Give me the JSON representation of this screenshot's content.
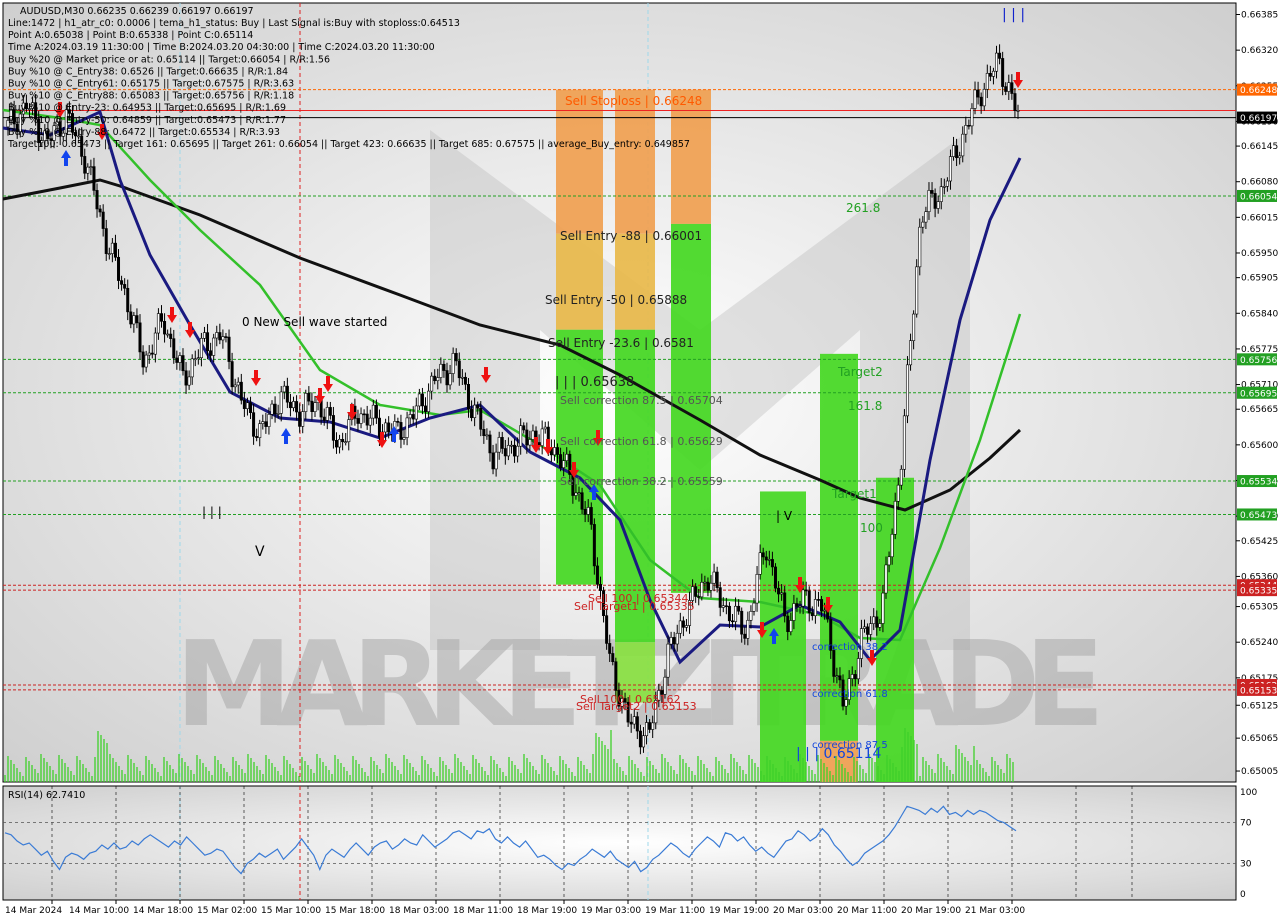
{
  "chart_data": [
    {
      "type": "candlestick",
      "symbol": "AUDUSD,M30",
      "ohlc_header": "AUDUSD,M30  0.66235 0.66239 0.66197 0.66197",
      "info_lines": [
        "Line:1472 | h1_atr_c0: 0.0006 | tema_h1_status: Buy | Last Signal is:Buy with stoploss:0.64513",
        "Point A:0.65038 | Point B:0.65338 | Point C:0.65114",
        "Time A:2024.03.19 11:30:00 | Time B:2024.03.20 04:30:00 | Time C:2024.03.20 11:30:00",
        "Buy %20 @ Market price or at: 0.65114 || Target:0.66054 | R/R:1.56",
        "Buy %10 @ C_Entry38: 0.6526 || Target:0.66635 | R/R:1.84",
        "Buy %10 @ C_Entry61: 0.65175 || Target:0.67575 | R/R:3.63",
        "Buy %10 @ C_Entry88: 0.65083 || Target:0.65756 | R/R:1.18",
        "Buy %10 @ Entry-23: 0.64953 || Target:0.65695 | R/R:1.69",
        "Buy %10 @ Entry-50: 0.64859 || Target:0.65473 | R/R:1.77",
        "Buy %10 @ Entry-88: 0.6472 || Target:0.65534 | R/R:3.93",
        "Target100: 0.65473 || Target 161: 0.65695 || Target 261: 0.66054 || Target 423: 0.66635 || Target 685: 0.67575 || average_Buy_entry: 0.649857"
      ],
      "y_ticks": [
        "0.66385",
        "0.66320",
        "0.66255",
        "0.66190",
        "0.66145",
        "0.66080",
        "0.66015",
        "0.65950",
        "0.65905",
        "0.65840",
        "0.65775",
        "0.65710",
        "0.65665",
        "0.65600",
        "0.65535",
        "0.65470",
        "0.65425",
        "0.65360",
        "0.65305",
        "0.65240",
        "0.65175",
        "0.65125",
        "0.65065",
        "0.65005"
      ],
      "price_labels": [
        {
          "text": "0.66248",
          "value": 0.66248,
          "color": "#ff6600"
        },
        {
          "text": "0.66197",
          "value": 0.66197,
          "color": "#000000"
        },
        {
          "text": "0.66054",
          "value": 0.66054,
          "color": "#22a022"
        },
        {
          "text": "0.65756",
          "value": 0.65756,
          "color": "#22a022"
        },
        {
          "text": "0.65695",
          "value": 0.65695,
          "color": "#22a022"
        },
        {
          "text": "0.65534",
          "value": 0.65534,
          "color": "#22a022"
        },
        {
          "text": "0.65473",
          "value": 0.65473,
          "color": "#22a022"
        },
        {
          "text": "0.65344",
          "value": 0.65344,
          "color": "#cc2222"
        },
        {
          "text": "0.65335",
          "value": 0.65335,
          "color": "#cc2222"
        },
        {
          "text": "0.65162",
          "value": 0.65162,
          "color": "#cc2222"
        },
        {
          "text": "0.65153",
          "value": 0.65153,
          "color": "#cc2222"
        }
      ],
      "annotations": [
        "Sell Stoploss | 0.66248",
        "Sell Entry -88 | 0.66001",
        "Sell Entry -50 | 0.65888",
        "Sell Entry -23.6 | 0.6581",
        "| | | 0.65638",
        "Sell correction 87.5 | 0.65704",
        "Sell correction 61.8 | 0.65629",
        "Sell correction 38.2 | 0.65559",
        "Sell 100 | 0.65344",
        "Sell Target1 | 0.65335",
        "Sell 100 | 0.65162",
        "Sell Target2 | 0.65153",
        "261.8",
        "Target2",
        "161.8",
        "Target1",
        "100",
        "correction 38.2",
        "correction 61.8",
        "correction 87.5",
        "| | | 0.65114",
        "0 New Sell wave started",
        "V",
        "| | |",
        "| V",
        "| | |"
      ],
      "watermark": "MARKETZITRADE",
      "x_labels": [
        "14 Mar 2024",
        "14 Mar 10:00",
        "14 Mar 18:00",
        "15 Mar 02:00",
        "15 Mar 10:00",
        "15 Mar 18:00",
        "18 Mar 03:00",
        "18 Mar 11:00",
        "18 Mar 19:00",
        "19 Mar 03:00",
        "19 Mar 11:00",
        "19 Mar 19:00",
        "20 Mar 03:00",
        "20 Mar 11:00",
        "20 Mar 19:00",
        "21 Mar 03:00"
      ],
      "price_path": [
        0.6618,
        0.6622,
        0.6615,
        0.662,
        0.6612,
        0.6598,
        0.6588,
        0.6575,
        0.6583,
        0.6572,
        0.6578,
        0.658,
        0.6568,
        0.6562,
        0.6569,
        0.6566,
        0.6568,
        0.656,
        0.6566,
        0.6564,
        0.6562,
        0.6566,
        0.6572,
        0.6575,
        0.6566,
        0.6558,
        0.656,
        0.6562,
        0.656,
        0.6554,
        0.6545,
        0.652,
        0.6509,
        0.6507,
        0.6522,
        0.653,
        0.6536,
        0.653,
        0.6526,
        0.6542,
        0.6528,
        0.6532,
        0.653,
        0.6512,
        0.6525,
        0.653,
        0.6558,
        0.6602,
        0.6606,
        0.6615,
        0.6624,
        0.663,
        0.662
      ]
    },
    {
      "type": "line",
      "title": "RSI(14) 62.7410",
      "y_ticks": [
        "100",
        "70",
        "30",
        "0"
      ],
      "ylim": [
        0,
        100
      ],
      "values": [
        60,
        58,
        52,
        48,
        50,
        44,
        38,
        42,
        32,
        24,
        36,
        40,
        38,
        34,
        40,
        42,
        48,
        44,
        50,
        44,
        46,
        52,
        48,
        54,
        58,
        54,
        50,
        46,
        52,
        48,
        56,
        50,
        44,
        38,
        40,
        44,
        42,
        34,
        26,
        20,
        30,
        34,
        40,
        36,
        40,
        44,
        34,
        40,
        46,
        54,
        46,
        38,
        24,
        38,
        44,
        40,
        36,
        44,
        50,
        44,
        38,
        46,
        50,
        52,
        44,
        48,
        54,
        50,
        48,
        58,
        52,
        46,
        50,
        54,
        60,
        62,
        58,
        54,
        62,
        60,
        64,
        54,
        50,
        56,
        50,
        46,
        52,
        44,
        36,
        38,
        34,
        28,
        24,
        30,
        28,
        34,
        38,
        44,
        40,
        36,
        42,
        34,
        30,
        26,
        32,
        22,
        26,
        34,
        38,
        44,
        50,
        46,
        40,
        36,
        44,
        50,
        56,
        52,
        46,
        60,
        58,
        52,
        56,
        48,
        42,
        46,
        40,
        36,
        44,
        52,
        54,
        62,
        58,
        52,
        56,
        64,
        58,
        48,
        42,
        34,
        28,
        32,
        40,
        44,
        48,
        52,
        58,
        66,
        76,
        86,
        84,
        82,
        78,
        84,
        80,
        86,
        78,
        80,
        76,
        82,
        78,
        82,
        80,
        76,
        72,
        70,
        66,
        62
      ]
    }
  ]
}
